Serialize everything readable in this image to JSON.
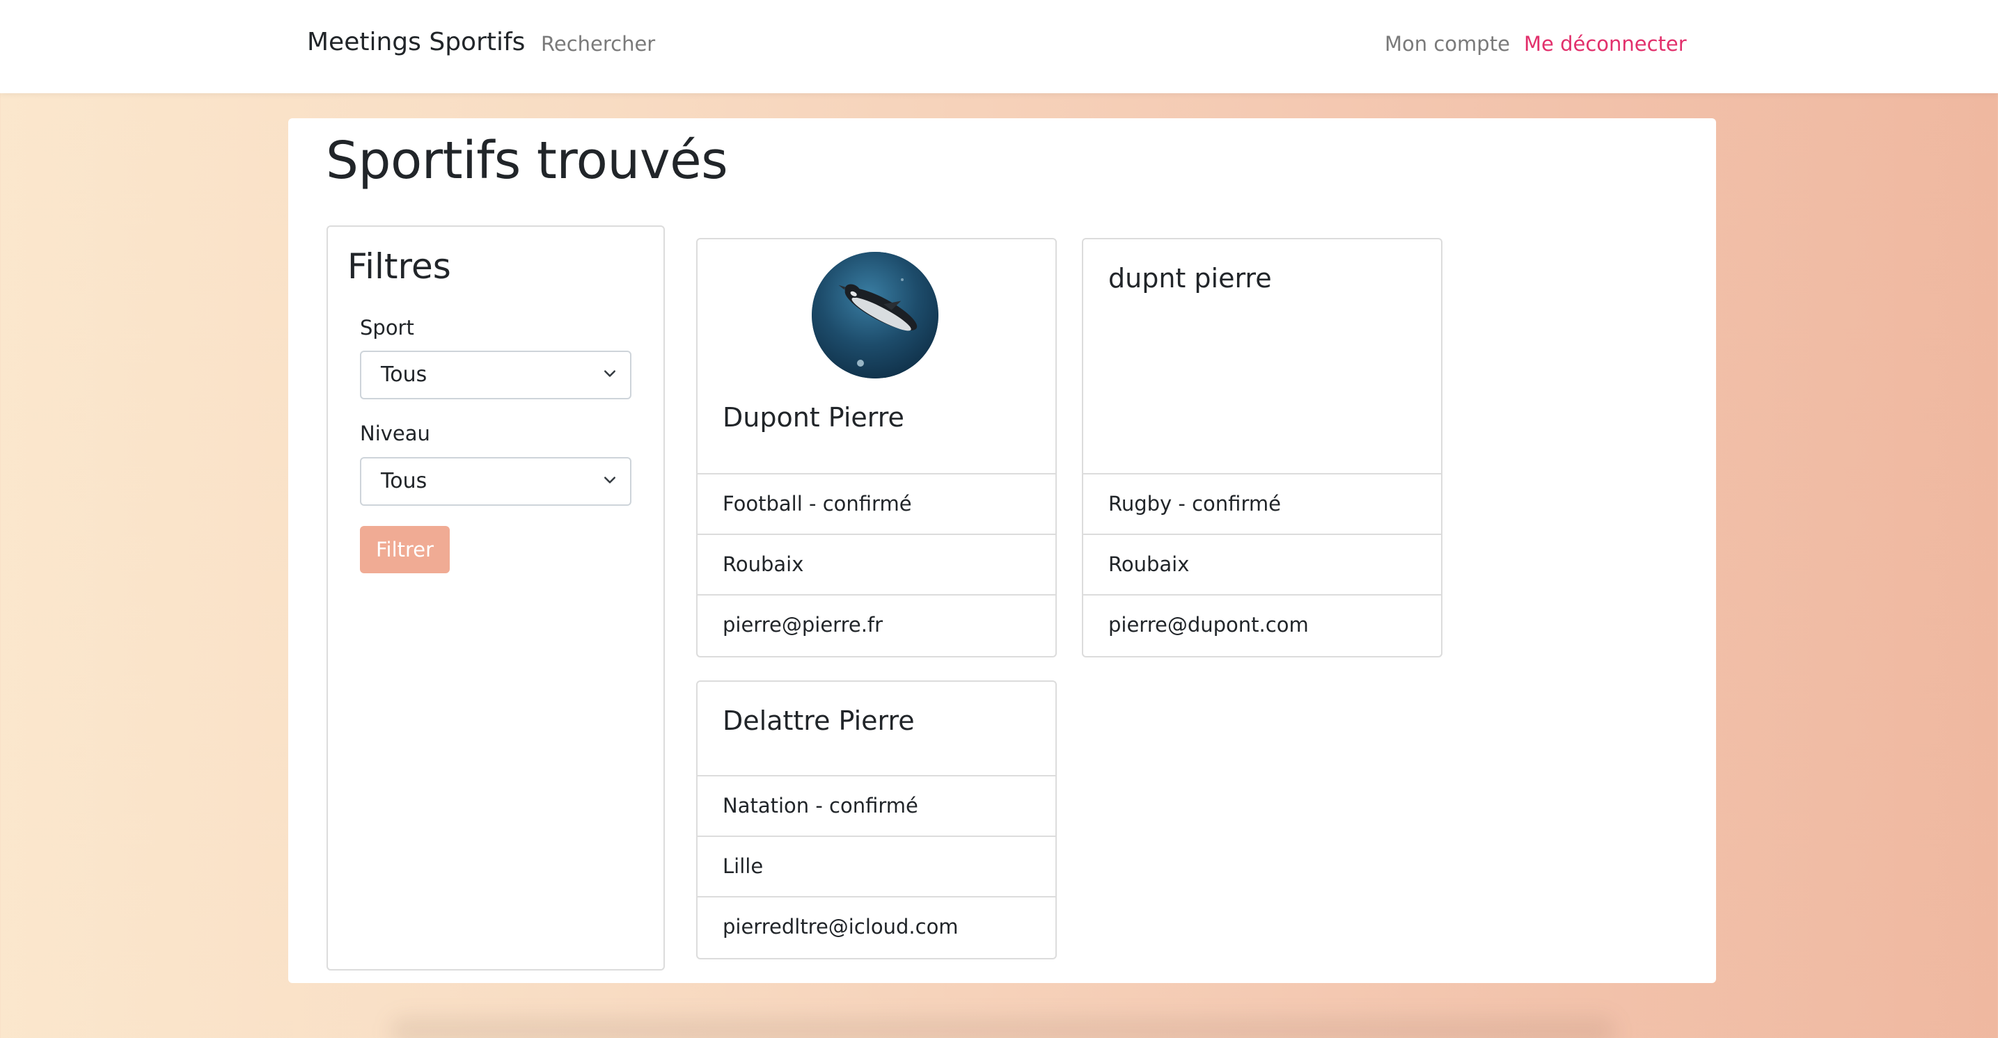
{
  "navbar": {
    "brand": "Meetings Sportifs",
    "search_link": "Rechercher",
    "account_link": "Mon compte",
    "logout_link": "Me déconnecter",
    "logout_color": "#e2306c"
  },
  "page": {
    "title": "Sportifs trouvés"
  },
  "filters": {
    "title": "Filtres",
    "sport_label": "Sport",
    "sport_value": "Tous",
    "level_label": "Niveau",
    "level_value": "Tous",
    "submit_label": "Filtrer",
    "submit_color": "#f0ab94"
  },
  "results": [
    {
      "name": "Dupont Pierre",
      "avatar": "penguin-underwater-photo",
      "sport_level": "Football - confirmé",
      "city": "Roubaix",
      "email": "pierre@pierre.fr"
    },
    {
      "name": "dupnt pierre",
      "sport_level": "Rugby - confirmé",
      "city": "Roubaix",
      "email": "pierre@dupont.com"
    },
    {
      "name": "Delattre Pierre",
      "sport_level": "Natation - confirmé",
      "city": "Lille",
      "email": "pierredltre@icloud.com"
    }
  ]
}
